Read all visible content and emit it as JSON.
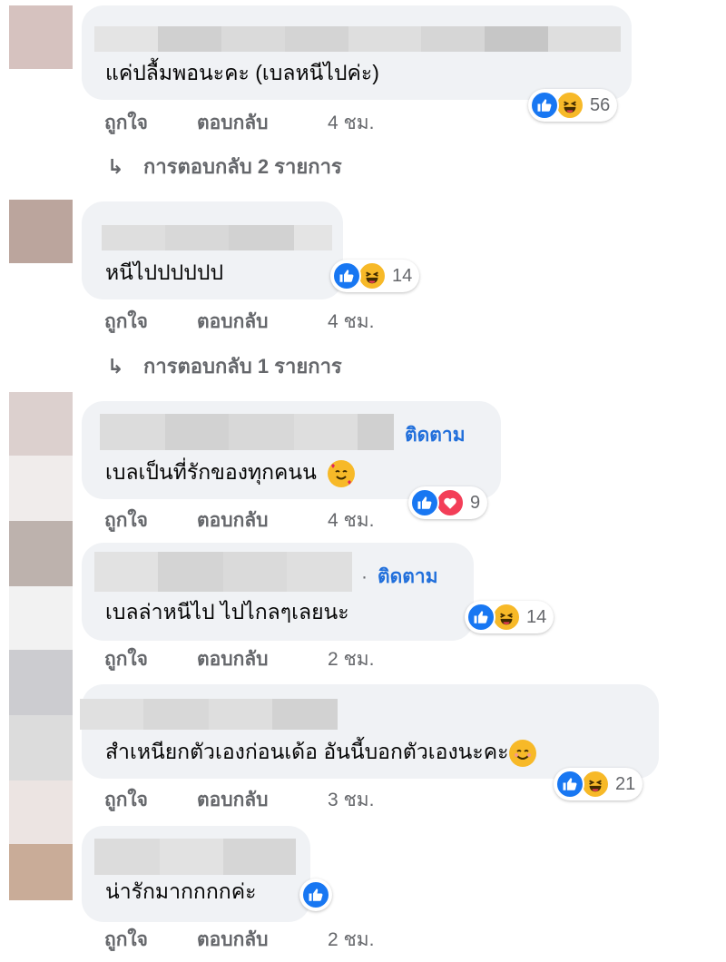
{
  "labels": {
    "like": "ถูกใจ",
    "reply": "ตอบกลับ",
    "follow": "ติดตาม",
    "dot": "·",
    "reply_arrow": "↳"
  },
  "comments": [
    {
      "text": "แค่ปลื้มพอนะคะ (เบลหนีไปค่ะ)",
      "reactions": [
        "like",
        "haha"
      ],
      "count": "56",
      "time": "4 ชม.",
      "replies": "การตอบกลับ 2 รายการ"
    },
    {
      "text": "หนีไปปปปปป",
      "reactions": [
        "like",
        "haha"
      ],
      "count": "14",
      "time": "4 ชม.",
      "replies": "การตอบกลับ 1 รายการ"
    },
    {
      "text": "เบลเป็นที่รักของทุกคนน",
      "emoji": "smiling-face-with-hearts",
      "reactions": [
        "like",
        "love"
      ],
      "count": "9",
      "time": "4 ชม."
    },
    {
      "text": "เบลล่าหนีไป ไปไกลๆเลยนะ",
      "reactions": [
        "like",
        "haha"
      ],
      "count": "14",
      "time": "2 ชม."
    },
    {
      "text": "สำเหนียกตัวเองก่อนเด้อ อันนี้บอกตัวเองนะคะ",
      "emoji": "smiling-face",
      "reactions": [
        "like",
        "haha"
      ],
      "count": "21",
      "time": "3 ชม."
    },
    {
      "text": "น่ารักมากกกกค่ะ",
      "reactions": [
        "like"
      ],
      "time": "2 ชม."
    }
  ],
  "colors": {
    "bubble": "#f0f2f5",
    "link": "#216fdb",
    "meta": "#65676b",
    "like": "#1877f2",
    "haha": "#f7b928",
    "love": "#f33e58"
  }
}
